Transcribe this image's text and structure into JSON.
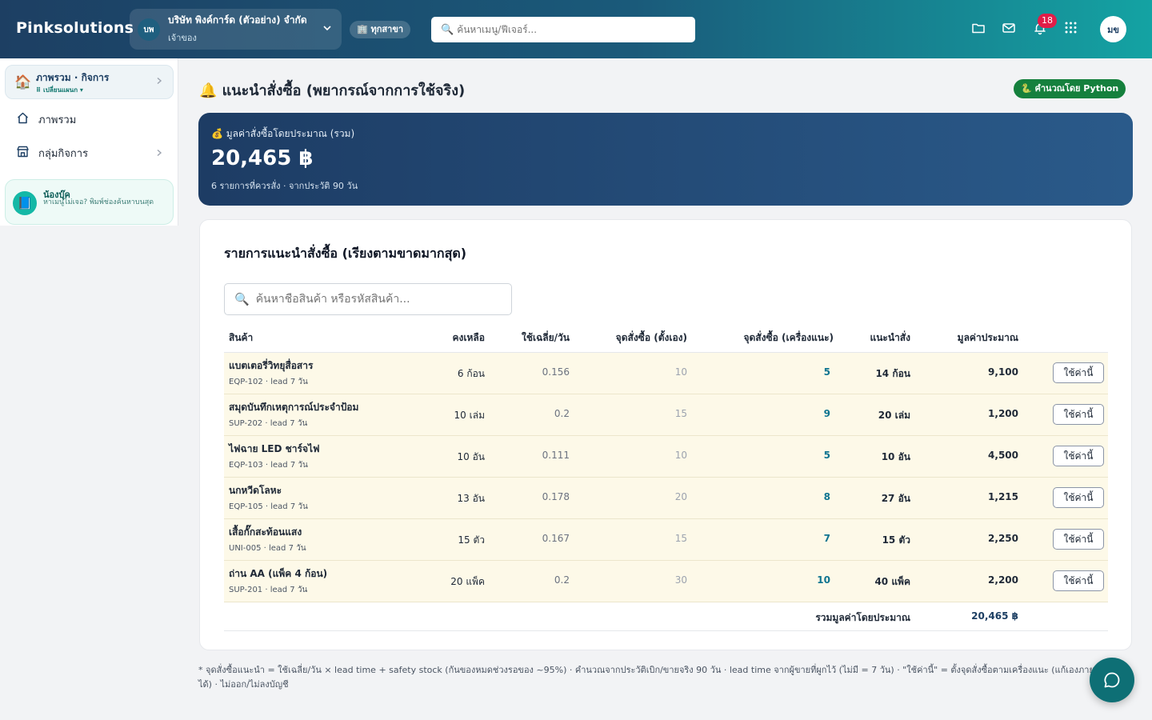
{
  "header": {
    "brand": "Pinksolutions",
    "company": {
      "initials": "บพ",
      "name": "บริษัท พิงค์การ์ด (ตัวอย่าง) จำกัด",
      "role": "เจ้าของ"
    },
    "branch": "🏢 ทุกสาขา",
    "search_placeholder": "ค้นหาเมนู/ฟีเจอร์...",
    "notification_count": "18",
    "user_initials": "มข"
  },
  "sidebar": {
    "card": {
      "title": "ภาพรวม · กิจการ",
      "subtitle": "⠿ เปลี่ยนแผนก ▾"
    },
    "items": [
      {
        "label": "ภาพรวม"
      },
      {
        "label": "กลุ่มกิจการ"
      }
    ],
    "helper": {
      "title": "น้องบุ๊ค",
      "text": "หาเมนูไม่เจอ? พิมพ์ช่องค้นหาบนสุด"
    }
  },
  "main": {
    "title": "🔔 แนะนำสั่งซื้อ (พยากรณ์จากการใช้จริง)",
    "python_badge": "🐍 คำนวณโดย Python",
    "summary": {
      "label": "💰 มูลค่าสั่งซื้อโดยประมาณ (รวม)",
      "amount": "20,465 ฿",
      "detail": "6 รายการที่ควรสั่ง · จากประวัติ 90 วัน"
    },
    "table": {
      "title": "รายการแนะนำสั่งซื้อ (เรียงตามขาดมากสุด)",
      "search_placeholder": "ค้นหาชื่อสินค้า หรือรหัสสินค้า...",
      "headers": {
        "product": "สินค้า",
        "stock": "คงเหลือ",
        "daily": "ใช้เฉลี่ย/วัน",
        "manual": "จุดสั่งซื้อ (ตั้งเอง)",
        "auto": "จุดสั่งซื้อ (เครื่องแนะ)",
        "suggest": "แนะนำสั่ง",
        "value": "มูลค่าประมาณ"
      },
      "rows": [
        {
          "name": "แบตเตอรี่วิทยุสื่อสาร",
          "sku": "EQP-102 · lead 7 วัน",
          "stock": "6 ก้อน",
          "daily": "0.156",
          "manual": "10",
          "auto": "5",
          "suggest": "14 ก้อน",
          "value": "9,100",
          "action": "ใช้ค่านี้"
        },
        {
          "name": "สมุดบันทึกเหตุการณ์ประจำป้อม",
          "sku": "SUP-202 · lead 7 วัน",
          "stock": "10 เล่ม",
          "daily": "0.2",
          "manual": "15",
          "auto": "9",
          "suggest": "20 เล่ม",
          "value": "1,200",
          "action": "ใช้ค่านี้"
        },
        {
          "name": "ไฟฉาย LED ชาร์จไฟ",
          "sku": "EQP-103 · lead 7 วัน",
          "stock": "10 อัน",
          "daily": "0.111",
          "manual": "10",
          "auto": "5",
          "suggest": "10 อัน",
          "value": "4,500",
          "action": "ใช้ค่านี้"
        },
        {
          "name": "นกหวีดโลหะ",
          "sku": "EQP-105 · lead 7 วัน",
          "stock": "13 อัน",
          "daily": "0.178",
          "manual": "20",
          "auto": "8",
          "suggest": "27 อัน",
          "value": "1,215",
          "action": "ใช้ค่านี้"
        },
        {
          "name": "เสื้อกั๊กสะท้อนแสง",
          "sku": "UNI-005 · lead 7 วัน",
          "stock": "15 ตัว",
          "daily": "0.167",
          "manual": "15",
          "auto": "7",
          "suggest": "15 ตัว",
          "value": "2,250",
          "action": "ใช้ค่านี้"
        },
        {
          "name": "ถ่าน AA (แพ็ค 4 ก้อน)",
          "sku": "SUP-201 · lead 7 วัน",
          "stock": "20 แพ็ค",
          "daily": "0.2",
          "manual": "30",
          "auto": "10",
          "suggest": "40 แพ็ค",
          "value": "2,200",
          "action": "ใช้ค่านี้"
        }
      ],
      "total_label": "รวมมูลค่าโดยประมาณ",
      "total_value": "20,465 ฿"
    },
    "footnote": "* จุดสั่งซื้อแนะนำ = ใช้เฉลี่ย/วัน × lead time + safety stock (กันของหมดช่วงรอของ ~95%) · คำนวณจากประวัติเบิก/ขายจริง 90 วัน · lead time จากผู้ขายที่ผูกไว้ (ไม่มี = 7 วัน) · \"ใช้ค่านี้\" = ตั้งจุดสั่งซื้อตามเครื่องแนะ (แก้เองภายหลังได้) · ไม่ออก/ไม่ลงบัญชี"
  }
}
